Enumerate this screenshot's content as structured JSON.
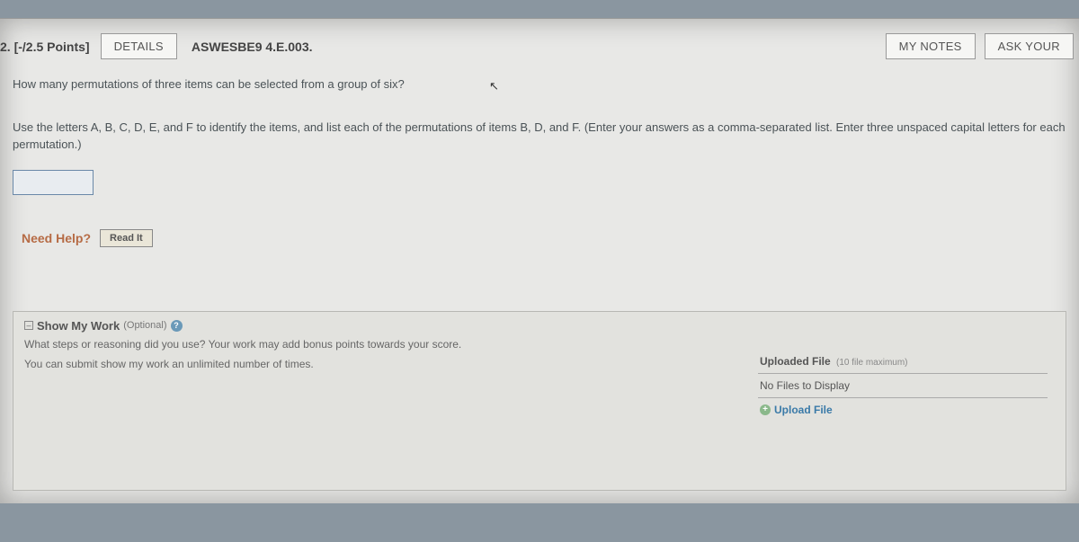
{
  "header": {
    "number_points": "2. [-/2.5 Points]",
    "details_btn": "DETAILS",
    "code": "ASWESBE9 4.E.003.",
    "my_notes_btn": "MY NOTES",
    "ask_teacher_btn": "ASK YOUR"
  },
  "question": {
    "line1": "How many permutations of three items can be selected from a group of six?",
    "line2": "Use the letters A, B, C, D, E, and F to identify the items, and list each of the permutations of items B, D, and F. (Enter your answers as a comma-separated list. Enter three unspaced capital letters for each permutation.)"
  },
  "need_help": {
    "label": "Need Help?",
    "read_it": "Read It"
  },
  "show_work": {
    "title": "Show My Work",
    "optional": "(Optional)",
    "desc1": "What steps or reasoning did you use? Your work may add bonus points towards your score.",
    "desc2": "You can submit show my work an unlimited number of times.",
    "uploaded_title": "Uploaded File",
    "uploaded_sub": "(10 file maximum)",
    "no_files": "No Files to Display",
    "upload_link": "Upload File"
  }
}
